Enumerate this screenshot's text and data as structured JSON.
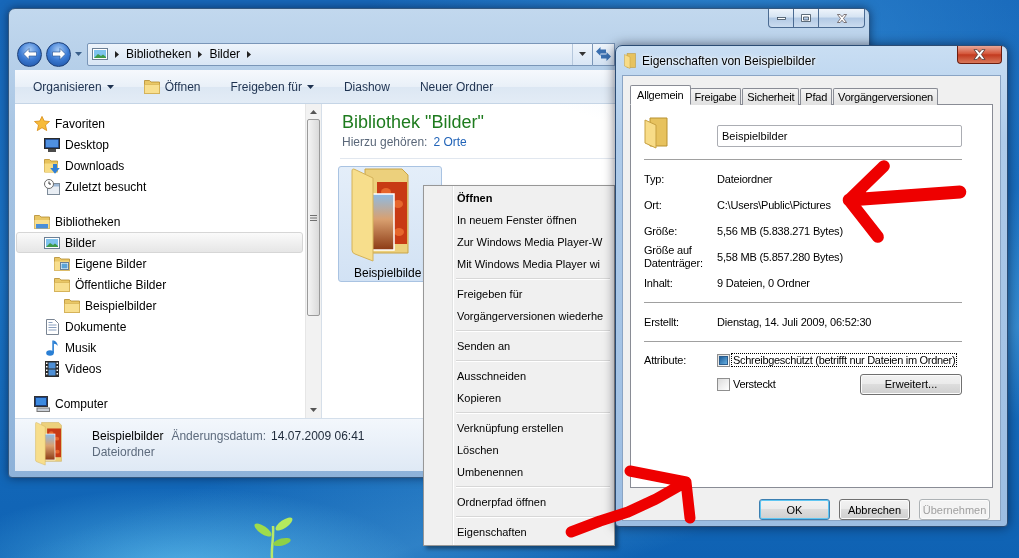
{
  "explorer": {
    "address_bar": {
      "segments": [
        "Bibliotheken",
        "Bilder"
      ]
    },
    "toolbar": [
      {
        "label": "Organisieren",
        "kind": "menu"
      },
      {
        "label": "Öffnen",
        "kind": "icon"
      },
      {
        "label": "Freigeben für",
        "kind": "menu"
      },
      {
        "label": "Diashow",
        "kind": "plain"
      },
      {
        "label": "Neuer Ordner",
        "kind": "plain"
      }
    ],
    "navigation": [
      {
        "label": "Favoriten",
        "kind": "favorites",
        "selected": false,
        "children": [
          {
            "label": "Desktop",
            "kind": "desktop",
            "selected": false
          },
          {
            "label": "Downloads",
            "kind": "downloads",
            "selected": false
          },
          {
            "label": "Zuletzt besucht",
            "kind": "recent",
            "selected": false
          }
        ]
      },
      {
        "label": "Bibliotheken",
        "kind": "libraries",
        "selected": false,
        "children": [
          {
            "label": "Bilder",
            "kind": "pictures",
            "selected": true,
            "children": [
              {
                "label": "Eigene Bilder",
                "kind": "picture-folder",
                "selected": false
              },
              {
                "label": "Öffentliche Bilder",
                "kind": "folder",
                "selected": false,
                "children": [
                  {
                    "label": "Beispielbilder",
                    "kind": "folder",
                    "selected": false
                  }
                ]
              }
            ]
          },
          {
            "label": "Dokumente",
            "kind": "documents",
            "selected": false
          },
          {
            "label": "Musik",
            "kind": "music",
            "selected": false
          },
          {
            "label": "Videos",
            "kind": "videos",
            "selected": false
          }
        ]
      },
      {
        "label": "Computer",
        "kind": "computer",
        "selected": false
      }
    ],
    "library": {
      "title": "Bibliothek \"Bilder\"",
      "includes_label": "Hierzu gehören:",
      "includes_link": "2 Orte"
    },
    "items": [
      {
        "label": "Beispielbilde",
        "selected": true
      }
    ],
    "details": {
      "name": "Beispielbilder",
      "date_label": "Änderungsdatum:",
      "date": "14.07.2009 06:41",
      "type": "Dateiordner"
    }
  },
  "context_menu": {
    "groups": [
      [
        {
          "label": "Öffnen",
          "default": true
        },
        {
          "label": "In neuem Fenster öffnen",
          "default": false
        },
        {
          "label": "Zur Windows Media Player-W",
          "default": false
        },
        {
          "label": "Mit Windows Media Player wi",
          "default": false
        }
      ],
      [
        {
          "label": "Freigeben für",
          "default": false
        },
        {
          "label": "Vorgängerversionen wiederhe",
          "default": false
        }
      ],
      [
        {
          "label": "Senden an",
          "default": false
        }
      ],
      [
        {
          "label": "Ausschneiden",
          "default": false
        },
        {
          "label": "Kopieren",
          "default": false
        }
      ],
      [
        {
          "label": "Verknüpfung erstellen",
          "default": false
        },
        {
          "label": "Löschen",
          "default": false
        },
        {
          "label": "Umbenennen",
          "default": false
        }
      ],
      [
        {
          "label": "Ordnerpfad öffnen",
          "default": false
        }
      ],
      [
        {
          "label": "Eigenschaften",
          "default": false
        }
      ]
    ]
  },
  "properties": {
    "title": "Eigenschaften von Beispielbilder",
    "tabs": [
      {
        "label": "Allgemein",
        "selected": true
      },
      {
        "label": "Freigabe",
        "selected": false
      },
      {
        "label": "Sicherheit",
        "selected": false
      },
      {
        "label": "Pfad",
        "selected": false
      },
      {
        "label": "Vorgängerversionen",
        "selected": false
      }
    ],
    "name_field": {
      "value": "Beispielbilder"
    },
    "sections": [
      [
        {
          "label": "Typ:",
          "value": "Dateiordner"
        },
        {
          "label": "Ort:",
          "value": "C:\\Users\\Public\\Pictures"
        },
        {
          "label": "Größe:",
          "value": "5,56 MB (5.838.271 Bytes)"
        },
        {
          "label": "Größe auf Datenträger:",
          "value": "5,58 MB (5.857.280 Bytes)"
        },
        {
          "label": "Inhalt:",
          "value": "9 Dateien, 0 Ordner"
        }
      ],
      [
        {
          "label": "Erstellt:",
          "value": "Dienstag, 14. Juli 2009, 06:52:30"
        }
      ]
    ],
    "attributes": {
      "label": "Attribute:",
      "options": [
        {
          "label": "Schreibgeschützt (betrifft nur Dateien im Ordner)",
          "checked": false,
          "indeterminate": true,
          "focused": true
        },
        {
          "label": "Versteckt",
          "checked": false,
          "indeterminate": false,
          "focused": false
        }
      ],
      "button": "Erweitert..."
    },
    "buttons": [
      {
        "label": "OK",
        "default": true,
        "disabled": false
      },
      {
        "label": "Abbrechen",
        "default": false,
        "disabled": false
      },
      {
        "label": "Übernehmen",
        "default": false,
        "disabled": true
      }
    ]
  }
}
